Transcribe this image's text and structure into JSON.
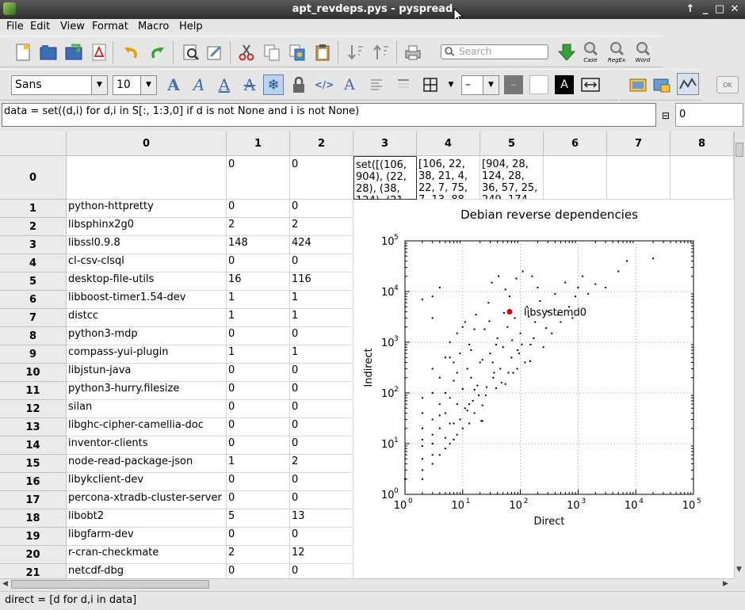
{
  "window": {
    "title": "apt_revdeps.pys - pyspread"
  },
  "menu": [
    "File",
    "Edit",
    "View",
    "Format",
    "Macro",
    "Help"
  ],
  "toolbar": {
    "search_placeholder": "Search",
    "case_label": "Case",
    "regex_label": "RegEx",
    "word_label": "Word",
    "font_family": "Sans",
    "font_size": "10",
    "line_width": "–",
    "text_color_glyph": "A",
    "ok_label": "OK"
  },
  "formula": {
    "text": "data = set((d,i) for d,i in S[:, 1:3,0] if d is not None and i is not None)",
    "table_value": "0"
  },
  "grid": {
    "columns": [
      "0",
      "1",
      "2",
      "3",
      "4",
      "5",
      "6",
      "7",
      "8"
    ],
    "row0": {
      "c1": "0",
      "c2": "0",
      "c3": "set([(106, 904), (22, 28), (38, 124), (21,",
      "c4": "[106, 22, 38, 21, 4, 22, 7, 75, 7, 13, 88,",
      "c5": "[904, 28, 124, 28, 36, 57, 25, 249, 174,"
    },
    "rows": [
      {
        "num": "1",
        "name": "python-httpretty",
        "direct": "0",
        "indirect": "0"
      },
      {
        "num": "2",
        "name": "libsphinx2g0",
        "direct": "2",
        "indirect": "2"
      },
      {
        "num": "3",
        "name": "libssl0.9.8",
        "direct": "148",
        "indirect": "424"
      },
      {
        "num": "4",
        "name": "cl-csv-clsql",
        "direct": "0",
        "indirect": "0"
      },
      {
        "num": "5",
        "name": "desktop-file-utils",
        "direct": "16",
        "indirect": "116"
      },
      {
        "num": "6",
        "name": "libboost-timer1.54-dev",
        "direct": "1",
        "indirect": "1"
      },
      {
        "num": "7",
        "name": "distcc",
        "direct": "1",
        "indirect": "1"
      },
      {
        "num": "8",
        "name": "python3-mdp",
        "direct": "0",
        "indirect": "0"
      },
      {
        "num": "9",
        "name": "compass-yui-plugin",
        "direct": "1",
        "indirect": "1"
      },
      {
        "num": "10",
        "name": "libjstun-java",
        "direct": "0",
        "indirect": "0"
      },
      {
        "num": "11",
        "name": "python3-hurry.filesize",
        "direct": "0",
        "indirect": "0"
      },
      {
        "num": "12",
        "name": "silan",
        "direct": "0",
        "indirect": "0"
      },
      {
        "num": "13",
        "name": "libghc-cipher-camellia-doc",
        "direct": "0",
        "indirect": "0"
      },
      {
        "num": "14",
        "name": "inventor-clients",
        "direct": "0",
        "indirect": "0"
      },
      {
        "num": "15",
        "name": "node-read-package-json",
        "direct": "1",
        "indirect": "2"
      },
      {
        "num": "16",
        "name": "libykclient-dev",
        "direct": "0",
        "indirect": "0"
      },
      {
        "num": "17",
        "name": "percona-xtradb-cluster-server",
        "direct": "0",
        "indirect": "0"
      },
      {
        "num": "18",
        "name": "libobt2",
        "direct": "5",
        "indirect": "13"
      },
      {
        "num": "19",
        "name": "libgfarm-dev",
        "direct": "0",
        "indirect": "0"
      },
      {
        "num": "20",
        "name": "r-cran-checkmate",
        "direct": "2",
        "indirect": "12"
      },
      {
        "num": "21",
        "name": "netcdf-dbg",
        "direct": "0",
        "indirect": "0"
      }
    ]
  },
  "chart_data": {
    "type": "scatter",
    "title": "Debian reverse dependencies",
    "xlabel": "Direct",
    "ylabel": "Indirect",
    "xscale": "log",
    "yscale": "log",
    "xlim": [
      1,
      100000
    ],
    "ylim": [
      1,
      100000
    ],
    "x_ticks": [
      "10^0",
      "10^1",
      "10^2",
      "10^3",
      "10^4",
      "10^5"
    ],
    "y_ticks": [
      "10^0",
      "10^1",
      "10^2",
      "10^3",
      "10^4",
      "10^5"
    ],
    "grid": true,
    "points": [
      [
        106,
        904
      ],
      [
        22,
        28
      ],
      [
        38,
        124
      ],
      [
        21,
        28
      ],
      [
        4,
        36
      ],
      [
        22,
        57
      ],
      [
        7,
        25
      ],
      [
        75,
        249
      ],
      [
        7,
        174
      ],
      [
        13,
        60
      ],
      [
        88,
        300
      ],
      [
        148,
        424
      ],
      [
        16,
        116
      ],
      [
        5,
        13
      ],
      [
        2,
        12
      ],
      [
        2,
        2
      ],
      [
        1,
        2
      ],
      [
        3,
        6
      ],
      [
        3,
        15
      ],
      [
        4,
        20
      ],
      [
        5,
        40
      ],
      [
        6,
        25
      ],
      [
        8,
        60
      ],
      [
        9,
        30
      ],
      [
        10,
        120
      ],
      [
        12,
        45
      ],
      [
        14,
        200
      ],
      [
        15,
        70
      ],
      [
        18,
        140
      ],
      [
        20,
        400
      ],
      [
        25,
        90
      ],
      [
        30,
        600
      ],
      [
        35,
        250
      ],
      [
        40,
        1200
      ],
      [
        45,
        300
      ],
      [
        50,
        800
      ],
      [
        55,
        150
      ],
      [
        60,
        2000
      ],
      [
        70,
        500
      ],
      [
        80,
        3000
      ],
      [
        90,
        700
      ],
      [
        100,
        1500
      ],
      [
        120,
        400
      ],
      [
        130,
        5000
      ],
      [
        150,
        900
      ],
      [
        180,
        2500
      ],
      [
        200,
        12000
      ],
      [
        250,
        800
      ],
      [
        300,
        4000
      ],
      [
        350,
        1500
      ],
      [
        400,
        9000
      ],
      [
        500,
        2500
      ],
      [
        600,
        15000
      ],
      [
        700,
        5000
      ],
      [
        900,
        8000
      ],
      [
        1200,
        20000
      ],
      [
        1500,
        9000
      ],
      [
        2000,
        14000
      ],
      [
        3000,
        12000
      ],
      [
        5000,
        25000
      ],
      [
        7000,
        40000
      ],
      [
        20000,
        45000
      ],
      [
        3,
        3000
      ],
      [
        3,
        8000
      ],
      [
        2,
        7000
      ],
      [
        4,
        12000
      ],
      [
        11,
        2500
      ],
      [
        6,
        500
      ],
      [
        8,
        1500
      ],
      [
        13,
        900
      ],
      [
        17,
        3500
      ],
      [
        24,
        1800
      ],
      [
        28,
        6000
      ],
      [
        32,
        15000
      ],
      [
        33,
        400
      ],
      [
        42,
        20000
      ],
      [
        55,
        11000
      ],
      [
        65,
        8000
      ],
      [
        85,
        18000
      ],
      [
        110,
        25000
      ],
      [
        160,
        20000
      ],
      [
        2,
        3
      ],
      [
        2,
        5
      ],
      [
        2,
        9
      ],
      [
        2,
        20
      ],
      [
        2,
        40
      ],
      [
        2,
        80
      ],
      [
        3,
        4
      ],
      [
        3,
        10
      ],
      [
        3,
        30
      ],
      [
        3,
        100
      ],
      [
        3,
        300
      ],
      [
        4,
        6
      ],
      [
        4,
        60
      ],
      [
        4,
        200
      ],
      [
        5,
        8
      ],
      [
        5,
        100
      ],
      [
        5,
        500
      ],
      [
        6,
        10
      ],
      [
        6,
        80
      ],
      [
        6,
        1000
      ],
      [
        7,
        12
      ],
      [
        7,
        400
      ],
      [
        8,
        15
      ],
      [
        8,
        250
      ],
      [
        9,
        600
      ],
      [
        10,
        20
      ],
      [
        10,
        2000
      ],
      [
        11,
        50
      ],
      [
        12,
        300
      ],
      [
        13,
        25
      ],
      [
        14,
        700
      ],
      [
        16,
        40
      ],
      [
        16,
        1800
      ],
      [
        19,
        90
      ],
      [
        22,
        450
      ],
      [
        26,
        130
      ],
      [
        29,
        2600
      ],
      [
        34,
        200
      ],
      [
        38,
        900
      ],
      [
        47,
        160
      ],
      [
        52,
        3800
      ],
      [
        62,
        250
      ],
      [
        72,
        1100
      ],
      [
        95,
        600
      ],
      [
        140,
        3200
      ],
      [
        170,
        1200
      ],
      [
        220,
        6500
      ],
      [
        280,
        1900
      ],
      [
        450,
        3500
      ],
      [
        800,
        3000
      ],
      [
        1000,
        12000
      ]
    ],
    "highlight": {
      "x": 65,
      "y": 4000,
      "label": "libsystemd0",
      "color": "#d40000"
    }
  },
  "status": {
    "text": "direct = [d for d,i in data]"
  }
}
